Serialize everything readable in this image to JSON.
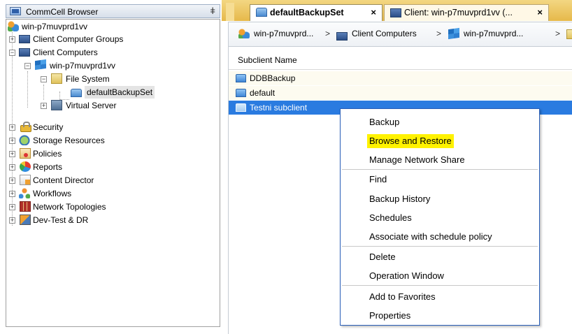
{
  "left_panel": {
    "title": "CommCell Browser",
    "pin_glyph": "ǂ",
    "tree": {
      "root": "win-p7muvprd1vv",
      "client_computer_groups": "Client Computer Groups",
      "client_computers": "Client Computers",
      "client": "win-p7muvprd1vv",
      "file_system": "File System",
      "backupset": "defaultBackupSet",
      "virtual_server": "Virtual Server",
      "security": "Security",
      "storage_resources": "Storage Resources",
      "policies": "Policies",
      "reports": "Reports",
      "content_director": "Content Director",
      "workflows": "Workflows",
      "network_topologies": "Network Topologies",
      "dev_test": "Dev-Test & DR"
    },
    "expand_glyph": "+",
    "collapse_glyph": "−"
  },
  "tabs": [
    {
      "label": "defaultBackupSet",
      "close": "×",
      "active": true
    },
    {
      "label": "Client: win-p7muvprd1vv (...",
      "close": "×",
      "active": false
    }
  ],
  "breadcrumb": {
    "items": [
      "win-p7muvprd...",
      "Client Computers",
      "win-p7muvprd..."
    ],
    "separator": ">"
  },
  "list": {
    "column_header": "Subclient Name",
    "rows": [
      "DDBBackup",
      "default",
      "Testni subclient"
    ],
    "selected_row": "Testni subclient"
  },
  "context_menu": {
    "items": [
      "Backup",
      "Browse and Restore",
      "Manage Network Share",
      "Find",
      "Backup History",
      "Schedules",
      "Associate with schedule policy",
      "Delete",
      "Operation Window",
      "Add to Favorites",
      "Properties"
    ],
    "highlighted": "Browse and Restore",
    "highlight_color": "#fff200"
  },
  "colors": {
    "selection_blue": "#2a7be0",
    "tab_strip": "#e6b94a",
    "menu_border": "#2a5fb8"
  }
}
